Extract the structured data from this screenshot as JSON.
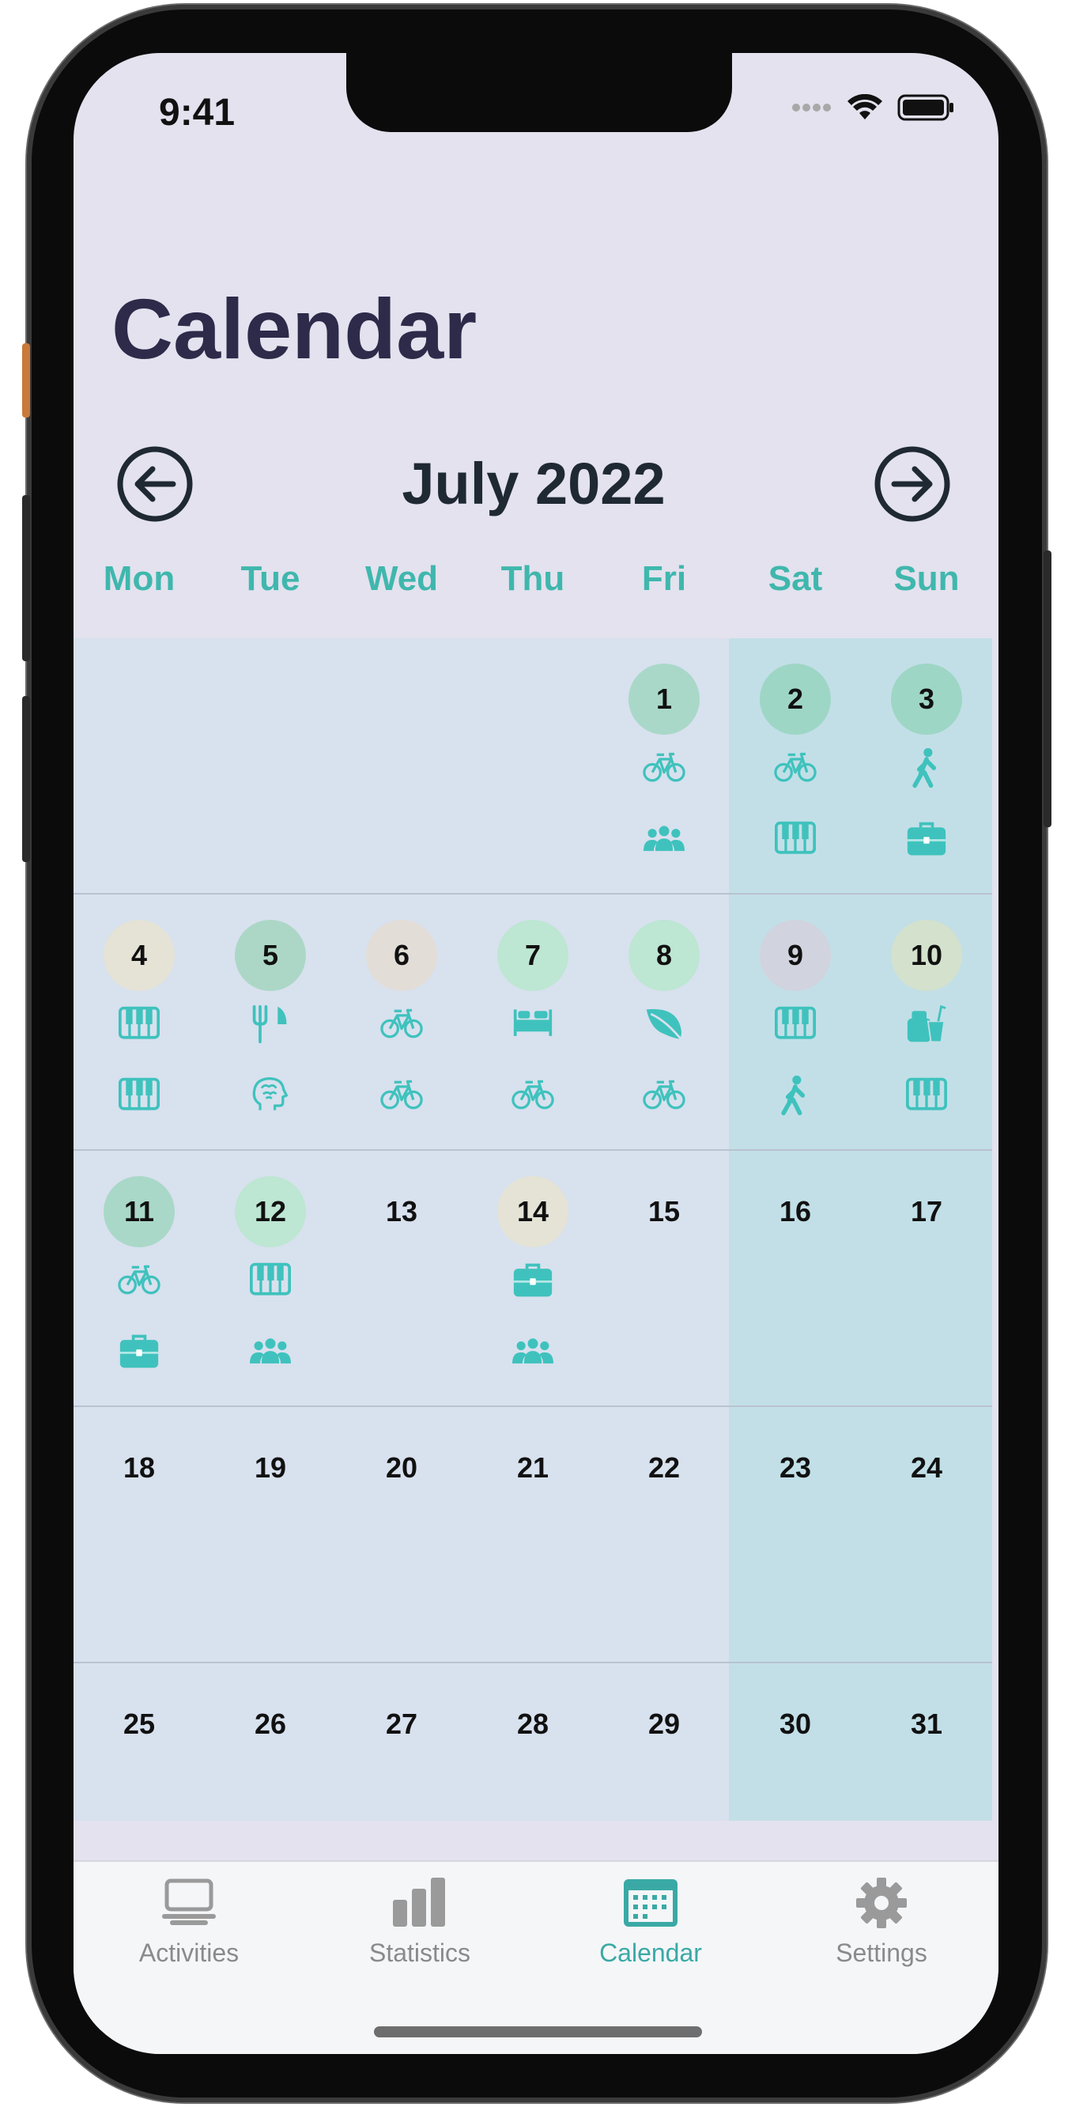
{
  "status": {
    "time": "9:41"
  },
  "header": {
    "title": "Calendar"
  },
  "nav": {
    "month": "July 2022"
  },
  "weekdays": [
    "Mon",
    "Tue",
    "Wed",
    "Thu",
    "Fri",
    "Sat",
    "Sun"
  ],
  "colors": {
    "accent": "#3fb7ad",
    "weekday": "#3fb7ad",
    "grid_bg": "#d8e1ee",
    "weekend_bg": "#c2dfe7"
  },
  "days": [
    {
      "d": "1",
      "col": 4,
      "row": 0,
      "bg": "#a9d8c8",
      "icons": [
        "bicycle-icon",
        "group-icon"
      ]
    },
    {
      "d": "2",
      "col": 5,
      "row": 0,
      "bg": "#9ed6c5",
      "icons": [
        "bicycle-icon",
        "piano-icon"
      ]
    },
    {
      "d": "3",
      "col": 6,
      "row": 0,
      "bg": "#9ed6c5",
      "icons": [
        "walking-icon",
        "briefcase-icon"
      ]
    },
    {
      "d": "4",
      "col": 0,
      "row": 1,
      "bg": "#e4e3d6",
      "icons": [
        "piano-icon",
        "piano-icon"
      ]
    },
    {
      "d": "5",
      "col": 1,
      "row": 1,
      "bg": "#acd7c7",
      "icons": [
        "fork-knife-icon",
        "brain-icon"
      ]
    },
    {
      "d": "6",
      "col": 2,
      "row": 1,
      "bg": "#e3ddd8",
      "icons": [
        "bicycle-icon",
        "bicycle-icon"
      ]
    },
    {
      "d": "7",
      "col": 3,
      "row": 1,
      "bg": "#bde6d3",
      "icons": [
        "bed-icon",
        "bicycle-icon"
      ]
    },
    {
      "d": "8",
      "col": 4,
      "row": 1,
      "bg": "#bde6d3",
      "icons": [
        "leaf-icon",
        "bicycle-icon"
      ]
    },
    {
      "d": "9",
      "col": 5,
      "row": 1,
      "bg": "#d1d3df",
      "icons": [
        "piano-icon",
        "walking-icon"
      ]
    },
    {
      "d": "10",
      "col": 6,
      "row": 1,
      "bg": "#d3e1cd",
      "icons": [
        "food-drink-icon",
        "piano-icon"
      ]
    },
    {
      "d": "11",
      "col": 0,
      "row": 2,
      "bg": "#a9d8c8",
      "icons": [
        "bicycle-icon",
        "briefcase-icon"
      ]
    },
    {
      "d": "12",
      "col": 1,
      "row": 2,
      "bg": "#bde6d3",
      "icons": [
        "piano-icon",
        "group-icon"
      ]
    },
    {
      "d": "13",
      "col": 2,
      "row": 2,
      "bg": "",
      "icons": []
    },
    {
      "d": "14",
      "col": 3,
      "row": 2,
      "bg": "#e4e3d6",
      "icons": [
        "briefcase-icon",
        "group-icon"
      ]
    },
    {
      "d": "15",
      "col": 4,
      "row": 2,
      "bg": "",
      "icons": []
    },
    {
      "d": "16",
      "col": 5,
      "row": 2,
      "bg": "",
      "icons": []
    },
    {
      "d": "17",
      "col": 6,
      "row": 2,
      "bg": "",
      "icons": []
    },
    {
      "d": "18",
      "col": 0,
      "row": 3,
      "bg": "",
      "icons": []
    },
    {
      "d": "19",
      "col": 1,
      "row": 3,
      "bg": "",
      "icons": []
    },
    {
      "d": "20",
      "col": 2,
      "row": 3,
      "bg": "",
      "icons": []
    },
    {
      "d": "21",
      "col": 3,
      "row": 3,
      "bg": "",
      "icons": []
    },
    {
      "d": "22",
      "col": 4,
      "row": 3,
      "bg": "",
      "icons": []
    },
    {
      "d": "23",
      "col": 5,
      "row": 3,
      "bg": "",
      "icons": []
    },
    {
      "d": "24",
      "col": 6,
      "row": 3,
      "bg": "",
      "icons": []
    },
    {
      "d": "25",
      "col": 0,
      "row": 4,
      "bg": "",
      "icons": []
    },
    {
      "d": "26",
      "col": 1,
      "row": 4,
      "bg": "",
      "icons": []
    },
    {
      "d": "27",
      "col": 2,
      "row": 4,
      "bg": "",
      "icons": []
    },
    {
      "d": "28",
      "col": 3,
      "row": 4,
      "bg": "",
      "icons": []
    },
    {
      "d": "29",
      "col": 4,
      "row": 4,
      "bg": "",
      "icons": []
    },
    {
      "d": "30",
      "col": 5,
      "row": 4,
      "bg": "",
      "icons": []
    },
    {
      "d": "31",
      "col": 6,
      "row": 4,
      "bg": "",
      "icons": []
    }
  ],
  "tabs": [
    {
      "label": "Activities",
      "icon": "activities-icon",
      "active": false
    },
    {
      "label": "Statistics",
      "icon": "bar-chart-icon",
      "active": false
    },
    {
      "label": "Calendar",
      "icon": "calendar-icon",
      "active": true
    },
    {
      "label": "Settings",
      "icon": "gear-icon",
      "active": false
    }
  ]
}
